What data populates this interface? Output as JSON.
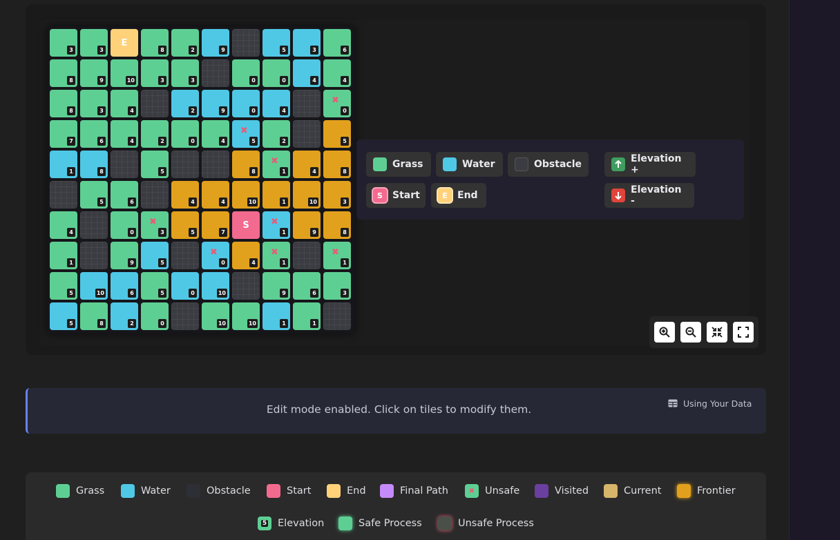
{
  "grid": {
    "rows": [
      [
        {
          "t": "grass",
          "e": "3"
        },
        {
          "t": "grass",
          "e": "3"
        },
        {
          "t": "end",
          "lbl": "E"
        },
        {
          "t": "grass",
          "e": "8"
        },
        {
          "t": "grass",
          "e": "2"
        },
        {
          "t": "water",
          "e": "9"
        },
        {
          "t": "obstacle"
        },
        {
          "t": "water",
          "e": "5"
        },
        {
          "t": "water",
          "e": "3"
        },
        {
          "t": "grass",
          "e": "6"
        }
      ],
      [
        {
          "t": "grass",
          "e": "8"
        },
        {
          "t": "grass",
          "e": "9"
        },
        {
          "t": "grass",
          "e": "10"
        },
        {
          "t": "grass",
          "e": "3"
        },
        {
          "t": "grass",
          "e": "3"
        },
        {
          "t": "obstacle"
        },
        {
          "t": "grass",
          "e": "0"
        },
        {
          "t": "grass",
          "e": "0"
        },
        {
          "t": "water",
          "e": "4"
        },
        {
          "t": "grass",
          "e": "4"
        }
      ],
      [
        {
          "t": "grass",
          "e": "8"
        },
        {
          "t": "grass",
          "e": "3"
        },
        {
          "t": "grass",
          "e": "4"
        },
        {
          "t": "obstacle"
        },
        {
          "t": "water",
          "e": "2"
        },
        {
          "t": "water",
          "e": "9"
        },
        {
          "t": "water",
          "e": "0"
        },
        {
          "t": "water",
          "e": "4"
        },
        {
          "t": "obstacle"
        },
        {
          "t": "grass",
          "e": "0",
          "x": true
        }
      ],
      [
        {
          "t": "grass",
          "e": "7"
        },
        {
          "t": "grass",
          "e": "6"
        },
        {
          "t": "grass",
          "e": "4"
        },
        {
          "t": "grass",
          "e": "2"
        },
        {
          "t": "grass",
          "e": "0"
        },
        {
          "t": "grass",
          "e": "4"
        },
        {
          "t": "water",
          "e": "5",
          "x": true
        },
        {
          "t": "grass",
          "e": "2"
        },
        {
          "t": "obstacle"
        },
        {
          "t": "frontier",
          "e": "5"
        }
      ],
      [
        {
          "t": "water",
          "e": "1"
        },
        {
          "t": "water",
          "e": "8"
        },
        {
          "t": "obstacle"
        },
        {
          "t": "grass",
          "e": "5"
        },
        {
          "t": "obstacle"
        },
        {
          "t": "obstacle"
        },
        {
          "t": "frontier",
          "e": "8"
        },
        {
          "t": "grass",
          "e": "1",
          "x": true
        },
        {
          "t": "frontier",
          "e": "4"
        },
        {
          "t": "frontier",
          "e": "8"
        }
      ],
      [
        {
          "t": "obstacle"
        },
        {
          "t": "grass",
          "e": "5"
        },
        {
          "t": "grass",
          "e": "6"
        },
        {
          "t": "obstacle"
        },
        {
          "t": "frontier",
          "e": "4"
        },
        {
          "t": "frontier",
          "e": "4"
        },
        {
          "t": "frontier",
          "e": "10"
        },
        {
          "t": "frontier",
          "e": "1"
        },
        {
          "t": "frontier",
          "e": "10"
        },
        {
          "t": "frontier",
          "e": "3"
        }
      ],
      [
        {
          "t": "grass",
          "e": "4"
        },
        {
          "t": "obstacle"
        },
        {
          "t": "grass",
          "e": "0"
        },
        {
          "t": "grass",
          "e": "3",
          "x": true
        },
        {
          "t": "frontier",
          "e": "5"
        },
        {
          "t": "frontier",
          "e": "7"
        },
        {
          "t": "start",
          "lbl": "S"
        },
        {
          "t": "water",
          "e": "1",
          "x": true
        },
        {
          "t": "frontier",
          "e": "9"
        },
        {
          "t": "frontier",
          "e": "8"
        }
      ],
      [
        {
          "t": "grass",
          "e": "1"
        },
        {
          "t": "obstacle"
        },
        {
          "t": "grass",
          "e": "9"
        },
        {
          "t": "water",
          "e": "5"
        },
        {
          "t": "obstacle"
        },
        {
          "t": "water",
          "e": "0",
          "x": true
        },
        {
          "t": "frontier",
          "e": "4"
        },
        {
          "t": "grass",
          "e": "1",
          "x": true
        },
        {
          "t": "obstacle"
        },
        {
          "t": "grass",
          "e": "1",
          "x": true
        }
      ],
      [
        {
          "t": "grass",
          "e": "5"
        },
        {
          "t": "water",
          "e": "10"
        },
        {
          "t": "water",
          "e": "6"
        },
        {
          "t": "grass",
          "e": "5"
        },
        {
          "t": "water",
          "e": "0"
        },
        {
          "t": "water",
          "e": "10"
        },
        {
          "t": "obstacle"
        },
        {
          "t": "grass",
          "e": "9"
        },
        {
          "t": "grass",
          "e": "6"
        },
        {
          "t": "grass",
          "e": "3"
        }
      ],
      [
        {
          "t": "water",
          "e": "5"
        },
        {
          "t": "grass",
          "e": "8"
        },
        {
          "t": "water",
          "e": "2"
        },
        {
          "t": "grass",
          "e": "0"
        },
        {
          "t": "obstacle"
        },
        {
          "t": "grass",
          "e": "10"
        },
        {
          "t": "grass",
          "e": "10"
        },
        {
          "t": "water",
          "e": "1"
        },
        {
          "t": "grass",
          "e": "1"
        },
        {
          "t": "obstacle"
        }
      ]
    ]
  },
  "palette": {
    "grass": "Grass",
    "water": "Water",
    "obstacle": "Obstacle",
    "start": "Start",
    "start_icon": "S",
    "end": "End",
    "end_icon": "E",
    "elev_up": "Elevation +",
    "elev_down": "Elevation -"
  },
  "status": {
    "message": "Edit mode enabled. Click on tiles to modify them.",
    "data_source": "Using Your Data"
  },
  "legend": {
    "items": [
      "Grass",
      "Water",
      "Obstacle",
      "Start",
      "End",
      "Final Path",
      "Unsafe",
      "Visited",
      "Current",
      "Frontier"
    ],
    "elevation": "Elevation",
    "elevation_sample": "5",
    "safe_process": "Safe Process",
    "unsafe_process": "Unsafe Process"
  },
  "colors": {
    "grass": "#5ecf93",
    "water": "#4fc8e6",
    "obstacle": "#3a3c42",
    "start": "#f36a8f",
    "end": "#ffd27a",
    "frontier": "#e2a11c",
    "final_path": "#c58af9",
    "visited": "#6b3fa0",
    "current": "#d6b46a",
    "accent": "#6a82ff"
  },
  "icons": {
    "zoom_in": "zoom-in-icon",
    "zoom_out": "zoom-out-icon",
    "fit": "fit-to-screen-icon",
    "fullscreen": "fullscreen-icon",
    "data": "table-icon"
  }
}
